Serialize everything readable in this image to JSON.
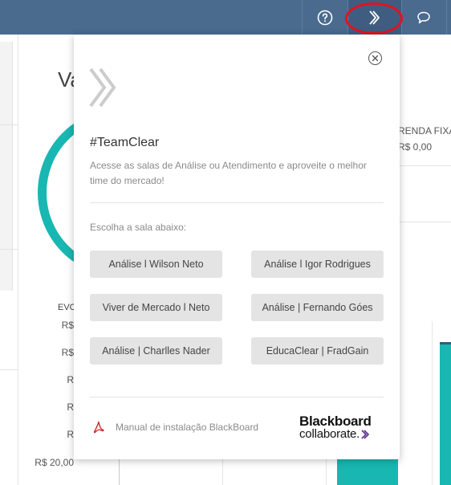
{
  "topbar": {
    "help_icon": "help-circle-icon",
    "clear_icon": "double-chevron-right-icon",
    "chat_icon": "chat-bubble-icon",
    "highlight_color": "#e3121f"
  },
  "background": {
    "title_partial": "Va",
    "renda_label": "RENDA FIXA",
    "renda_value": "R$ 0,00",
    "evolution_label": "EVO",
    "y_labels": [
      "R$",
      "R$",
      "R",
      "R",
      "R",
      "R$ 20,00"
    ],
    "accent": "#19b7b1"
  },
  "popup": {
    "close_icon": "close-circle-icon",
    "logo_icon": "double-chevron-right-icon",
    "title": "#TeamClear",
    "description": "Acesse as salas de Análise ou Atendimento e aproveite o melhor time do mercado!",
    "choose_label": "Escolha a sala abaixo:",
    "rooms": [
      {
        "label": "Análise l Wilson Neto"
      },
      {
        "label": "Análise l Igor Rodrigues"
      },
      {
        "label": "Viver de Mercado l Neto"
      },
      {
        "label": "Análise | Fernando Góes"
      },
      {
        "label": "Análise | Charlles Nader"
      },
      {
        "label": "EducaClear | FradGain"
      }
    ],
    "manual_label": "Manual de instalação BlackBoard",
    "manual_icon": "pdf-icon",
    "brand": {
      "line1": "Blackboard",
      "line2": "collaborate."
    }
  }
}
